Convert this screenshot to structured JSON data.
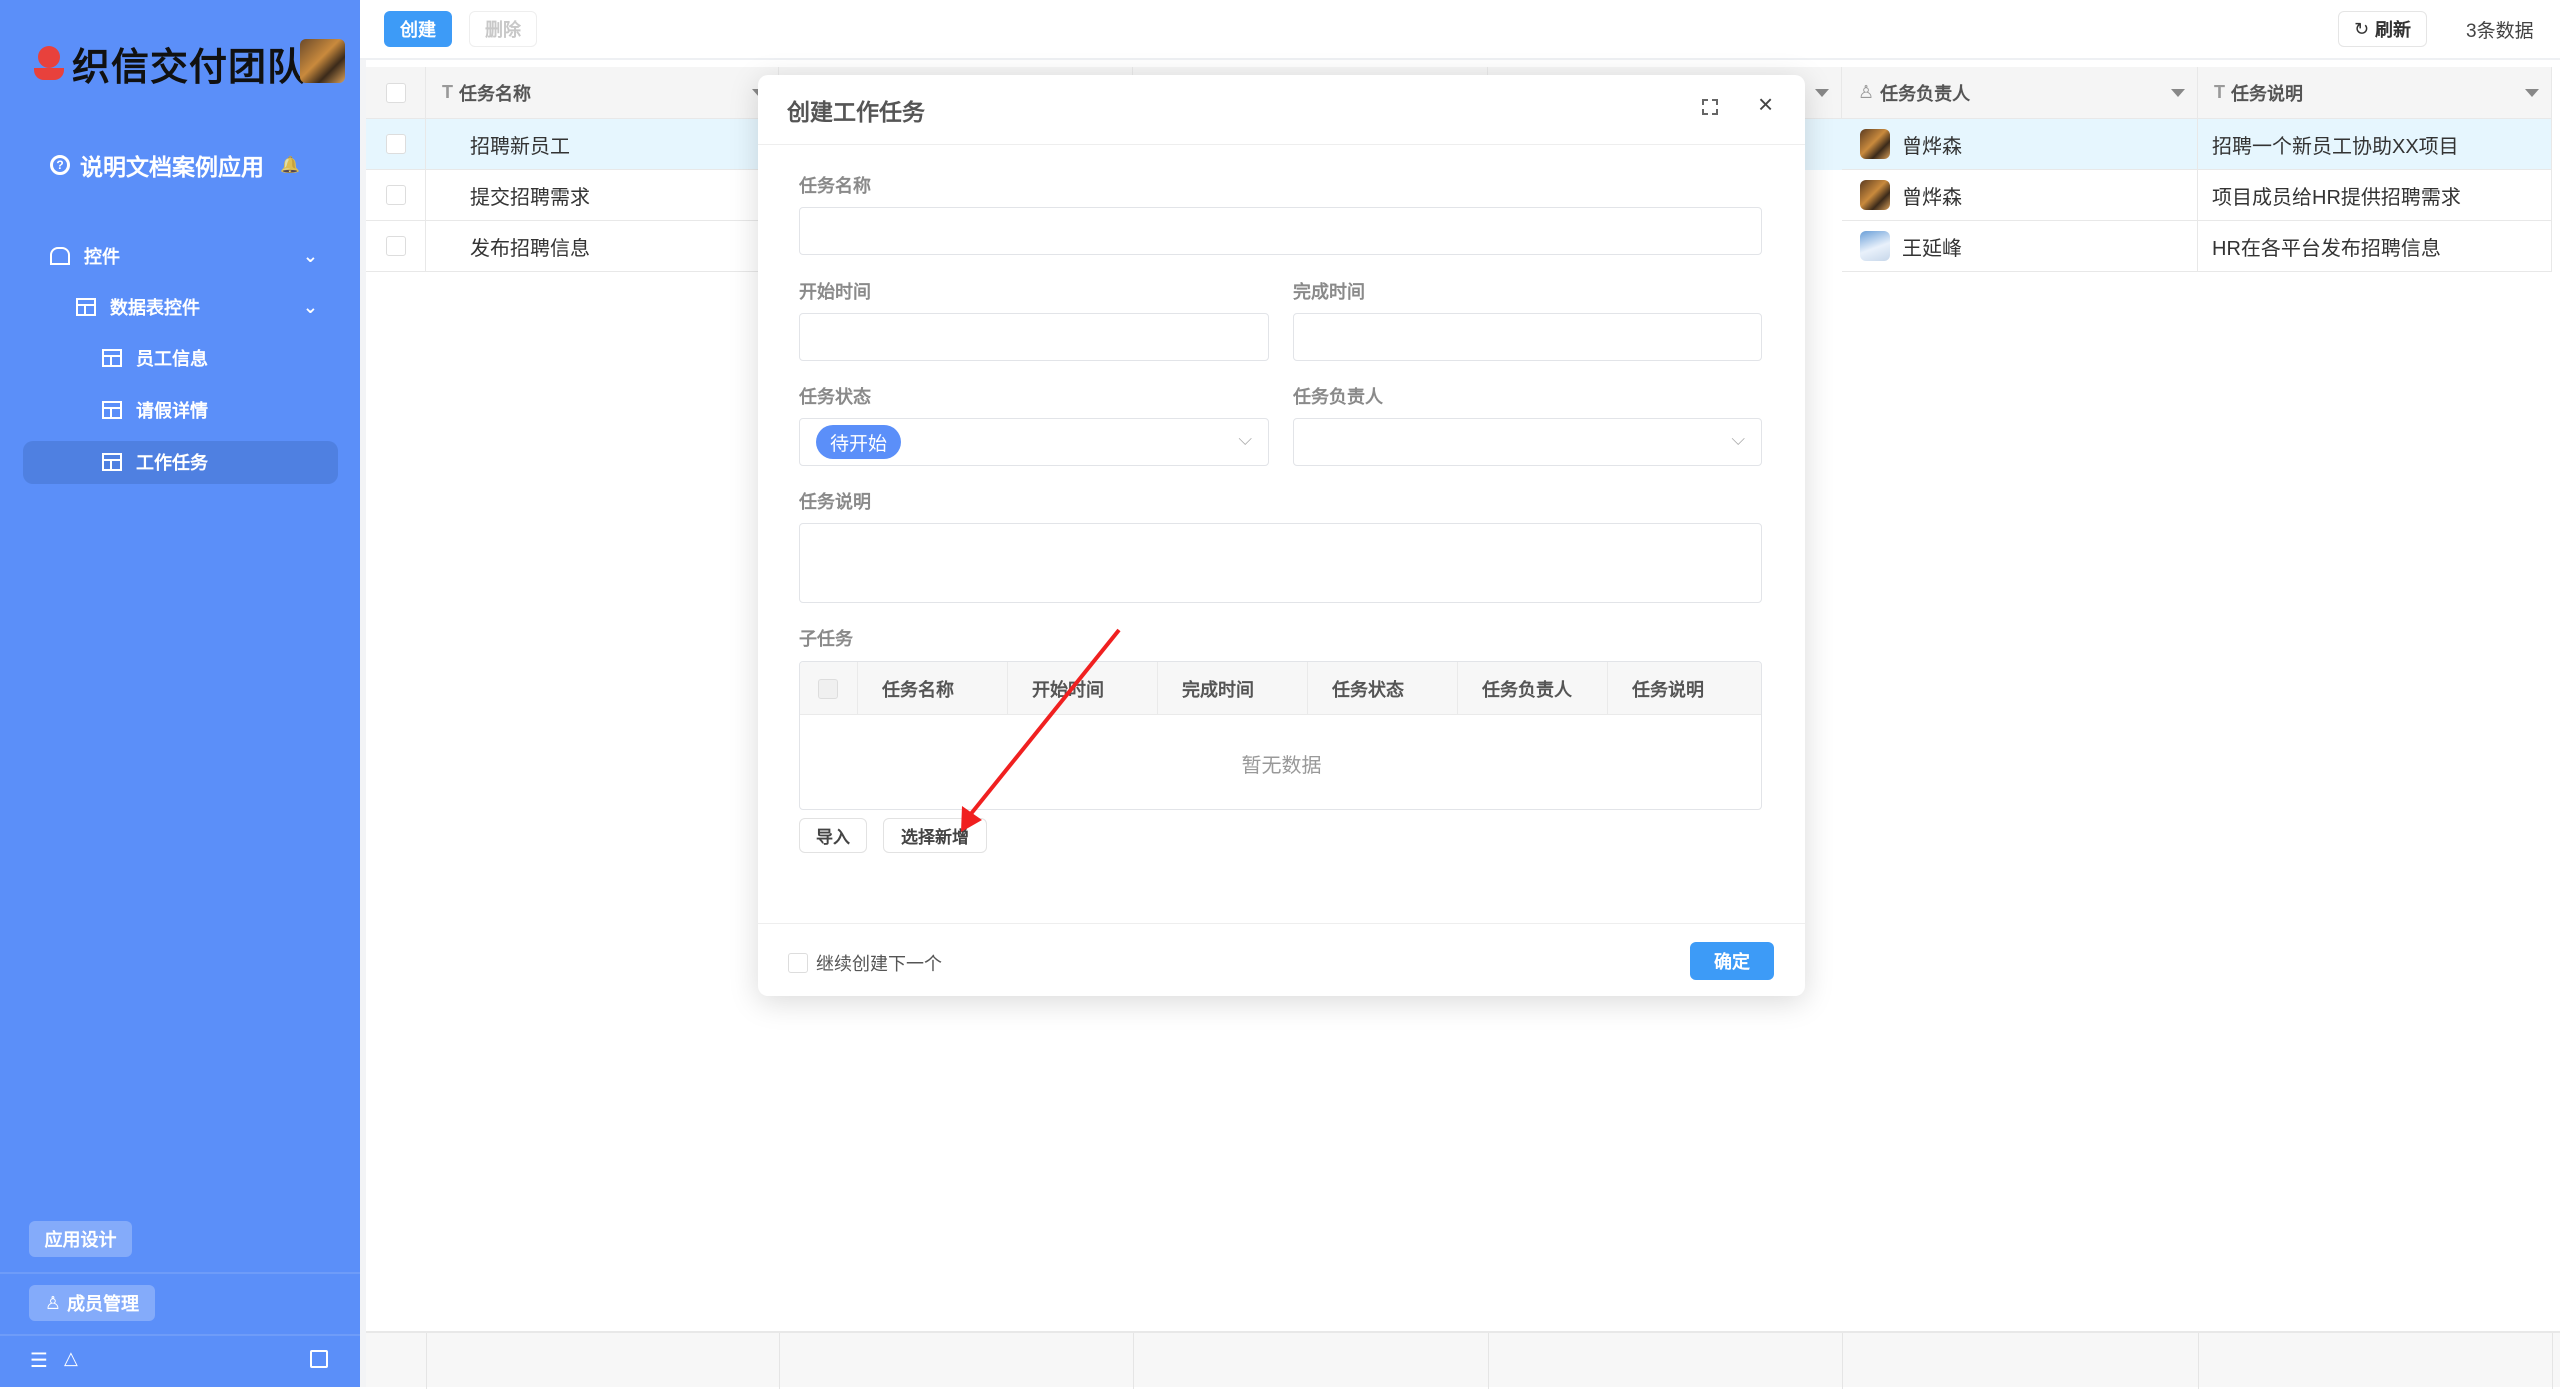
{
  "sidebar": {
    "logo_text": "织信交付团队",
    "app_name": "说明文档案例应用",
    "menu": [
      {
        "label": "控件",
        "icon": "home-icon"
      },
      {
        "label": "数据表控件",
        "icon": "table-icon"
      },
      {
        "label": "员工信息",
        "icon": "table-icon"
      },
      {
        "label": "请假详情",
        "icon": "table-icon"
      },
      {
        "label": "工作任务",
        "icon": "table-icon",
        "active": true
      }
    ],
    "app_design": "应用设计",
    "member_mgmt": "成员管理",
    "accent": "#5b8ff9"
  },
  "toolbar": {
    "create": "创建",
    "delete": "删除",
    "refresh": "刷新",
    "count": "3条数据"
  },
  "table": {
    "headers": {
      "name": "任务名称",
      "owner": "任务负责人",
      "desc": "任务说明"
    },
    "rows": [
      {
        "name": "招聘新员工",
        "owner": "曾烨森",
        "desc": "招聘一个新员工协助XX项目"
      },
      {
        "name": "提交招聘需求",
        "owner": "曾烨森",
        "desc": "项目成员给HR提供招聘需求"
      },
      {
        "name": "发布招聘信息",
        "owner": "王延峰",
        "desc": "HR在各平台发布招聘信息"
      }
    ]
  },
  "modal": {
    "title": "创建工作任务",
    "fields": {
      "name": {
        "label": "任务名称",
        "value": ""
      },
      "start": {
        "label": "开始时间",
        "value": ""
      },
      "end": {
        "label": "完成时间",
        "value": ""
      },
      "status": {
        "label": "任务状态",
        "value": "待开始"
      },
      "owner": {
        "label": "任务负责人",
        "value": ""
      },
      "desc": {
        "label": "任务说明",
        "value": ""
      }
    },
    "subtask": {
      "label": "子任务",
      "columns": [
        "任务名称",
        "开始时间",
        "完成时间",
        "任务状态",
        "任务负责人",
        "任务说明"
      ],
      "empty": "暂无数据",
      "import": "导入",
      "select_add": "选择新增"
    },
    "continue_label": "继续创建下一个",
    "confirm": "确定"
  }
}
